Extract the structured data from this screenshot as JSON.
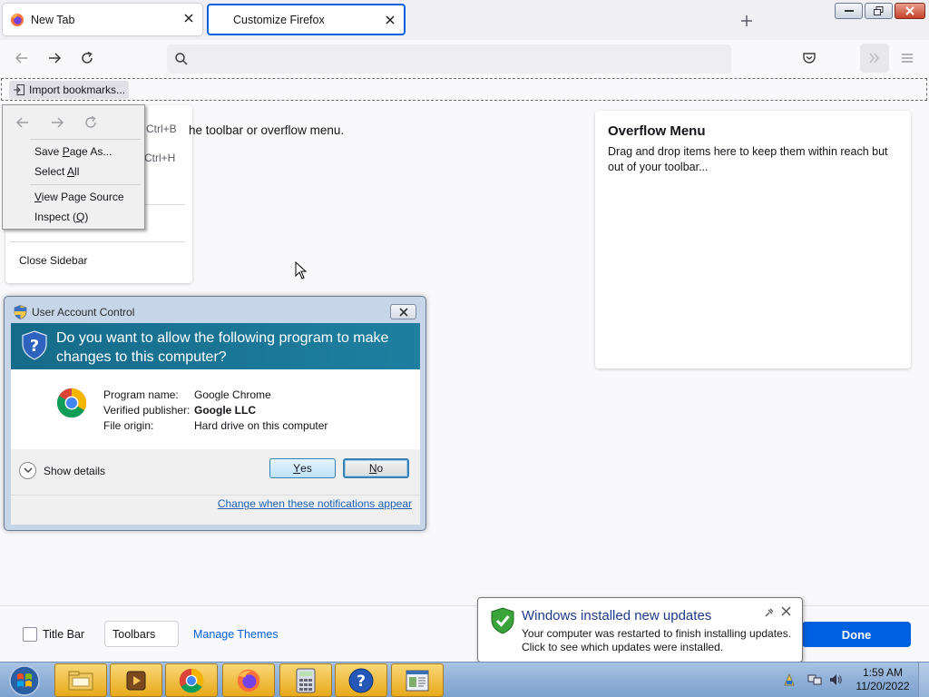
{
  "tabs": [
    {
      "label": "New Tab"
    },
    {
      "label": "Customize Firefox"
    }
  ],
  "bookmarks": {
    "import_label": "Import bookmarks..."
  },
  "left_panel": {
    "shortcut_b": "Ctrl+B",
    "shortcut_h": "Ctrl+H",
    "close_sidebar": "Close Sidebar"
  },
  "headline": "he toolbar or overflow menu.",
  "context_menu": {
    "items": [
      {
        "before": "Save ",
        "accel": "P",
        "after": "age As..."
      },
      {
        "before": "Select ",
        "accel": "A",
        "after": "ll"
      },
      {
        "before": "",
        "accel": "V",
        "after": "iew Page Source"
      },
      {
        "before": "Inspect (",
        "accel": "Q",
        "after": ")"
      }
    ]
  },
  "overflow_menu": {
    "title": "Overflow Menu",
    "description": "Drag and drop items here to keep them within reach but out of your toolbar..."
  },
  "bottom_bar": {
    "title_bar_label": "Title Bar",
    "title_bar_checked": false,
    "toolbars_label": "Toolbars",
    "manage_themes": "Manage Themes",
    "done": "Done"
  },
  "uac": {
    "title": "User Account Control",
    "question": "Do you want to allow the following program to make changes to this computer?",
    "program_name_label": "Program name:",
    "program_name": "Google Chrome",
    "publisher_label": "Verified publisher:",
    "publisher": "Google LLC",
    "origin_label": "File origin:",
    "origin": "Hard drive on this computer",
    "show_details": "Show details",
    "yes_accel": "Y",
    "yes_rest": "es",
    "no_accel": "N",
    "no_rest": "o",
    "change_link": "Change when these notifications appear"
  },
  "notification": {
    "title": "Windows installed new updates",
    "line1": "Your computer was restarted to finish installing updates.",
    "line2": "Click to see which updates were installed."
  },
  "taskbar": {
    "time": "1:59 AM",
    "date": "11/20/2022",
    "apps": [
      "explorer-icon",
      "media-player-icon",
      "chrome-icon",
      "firefox-icon",
      "calculator-icon",
      "help-icon",
      "control-panel-icon"
    ]
  },
  "colors": {
    "accent": "#0061e0",
    "uac_banner": "#156b8a",
    "taskbar_active": "#e8a91a"
  }
}
